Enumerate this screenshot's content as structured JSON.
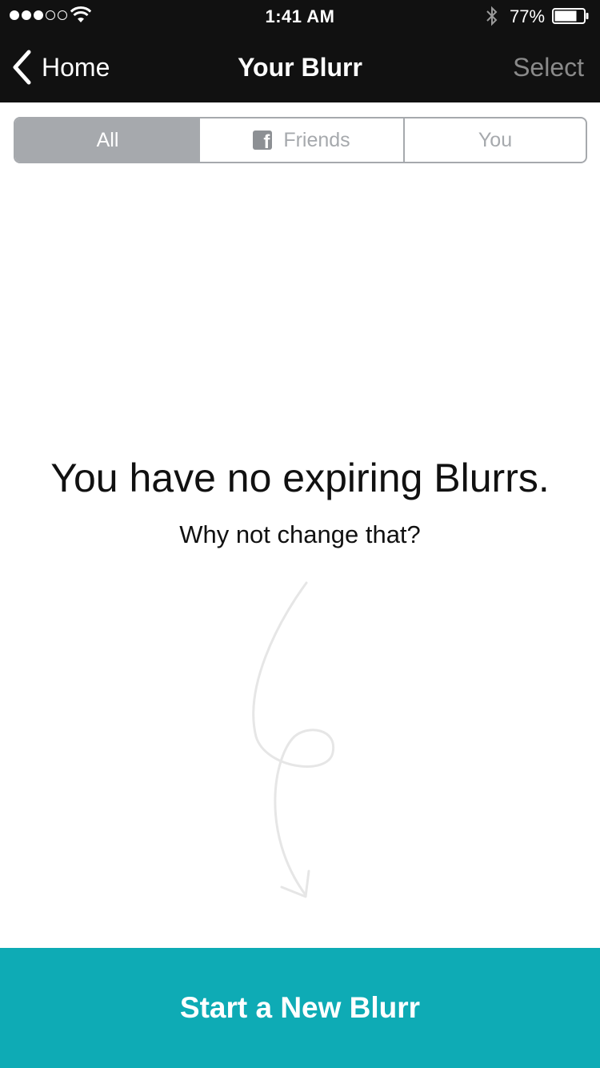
{
  "status_bar": {
    "time": "1:41 AM",
    "battery_percent": "77%",
    "battery_level": 0.77,
    "signal_bars_filled": 3,
    "signal_bars_total": 5
  },
  "nav": {
    "back_label": "Home",
    "title": "Your Blurr",
    "select_label": "Select"
  },
  "segments": {
    "all": "All",
    "friends": "Friends",
    "you": "You",
    "selected": "All"
  },
  "empty_state": {
    "title": "You have no expiring Blurrs.",
    "subtitle": "Why not change that?"
  },
  "cta": {
    "label": "Start a New Blurr"
  },
  "colors": {
    "bar_background": "#111111",
    "accent": "#0eabb5",
    "segment_active": "#a6a9ad"
  }
}
